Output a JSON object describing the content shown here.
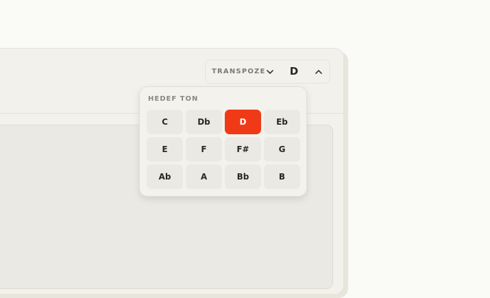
{
  "transpose": {
    "label": "TRANSPOZE",
    "current_key": "D",
    "down_icon": "chevron-down-icon",
    "up_icon": "chevron-up-icon"
  },
  "key_picker": {
    "title": "HEDEF TON",
    "selected": "D",
    "keys": [
      "C",
      "Db",
      "D",
      "Eb",
      "E",
      "F",
      "F#",
      "G",
      "Ab",
      "A",
      "Bb",
      "B"
    ]
  },
  "colors": {
    "accent": "#f03a17",
    "surface": "#f3f1ec",
    "key_bg": "#ebe9e4",
    "text": "#2a2623"
  }
}
